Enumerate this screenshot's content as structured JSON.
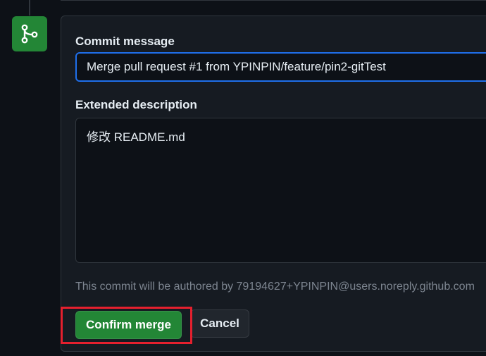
{
  "merge_form": {
    "merge_icon": "git-merge-icon",
    "commit_message_label": "Commit message",
    "commit_message_value": "Merge pull request #1 from YPINPIN/feature/pin2-gitTest",
    "extended_description_label": "Extended description",
    "extended_description_value": "修改 README.md",
    "author_note": "This commit will be authored by 79194627+YPINPIN@users.noreply.github.com",
    "confirm_button_label": "Confirm merge",
    "cancel_button_label": "Cancel"
  },
  "colors": {
    "background": "#0d1117",
    "panel": "#161b22",
    "border": "#30363d",
    "accent_green": "#238636",
    "focus_blue": "#1f6feb",
    "highlight_red": "#e5202e"
  }
}
